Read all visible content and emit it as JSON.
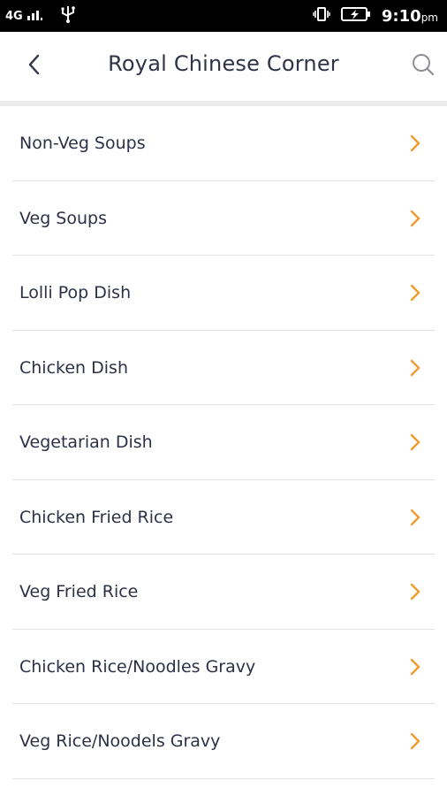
{
  "status_bar": {
    "network_label": "4G",
    "time": "9:10",
    "ampm": "pm"
  },
  "app_bar": {
    "title": "Royal Chinese Corner",
    "back_icon": "chevron-left-icon",
    "search_icon": "search-icon"
  },
  "colors": {
    "accent": "#f39a2c",
    "text": "#2c3147",
    "separator": "#e3e3e3"
  },
  "menu": {
    "items": [
      {
        "label": "Non-Veg Soups"
      },
      {
        "label": "Veg Soups"
      },
      {
        "label": "Lolli Pop Dish"
      },
      {
        "label": "Chicken Dish"
      },
      {
        "label": "Vegetarian Dish"
      },
      {
        "label": "Chicken Fried Rice"
      },
      {
        "label": "Veg Fried Rice"
      },
      {
        "label": "Chicken Rice/Noodles Gravy"
      },
      {
        "label": "Veg Rice/Noodels Gravy"
      }
    ]
  }
}
